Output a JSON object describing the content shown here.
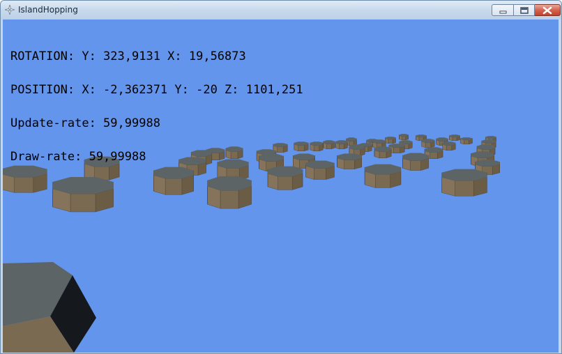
{
  "window": {
    "title": "IslandHopping",
    "controls": {
      "minimize": "minimize-icon",
      "maximize": "maximize-icon",
      "close": "close-icon"
    }
  },
  "hud": {
    "rotation": "ROTATION: Y: 323,9131 X: 19,56873",
    "position": "POSITION: X: -2,362371 Y: -20 Z: 1101,251",
    "update_rate": "Update-rate: 59,99988",
    "draw_rate": "Draw-rate: 59,99988"
  },
  "colors": {
    "sky": "#6495ed",
    "pillar_side": "#7a6a52",
    "pillar_top": "#5c6466",
    "pillar_shadow": "#15191e"
  }
}
